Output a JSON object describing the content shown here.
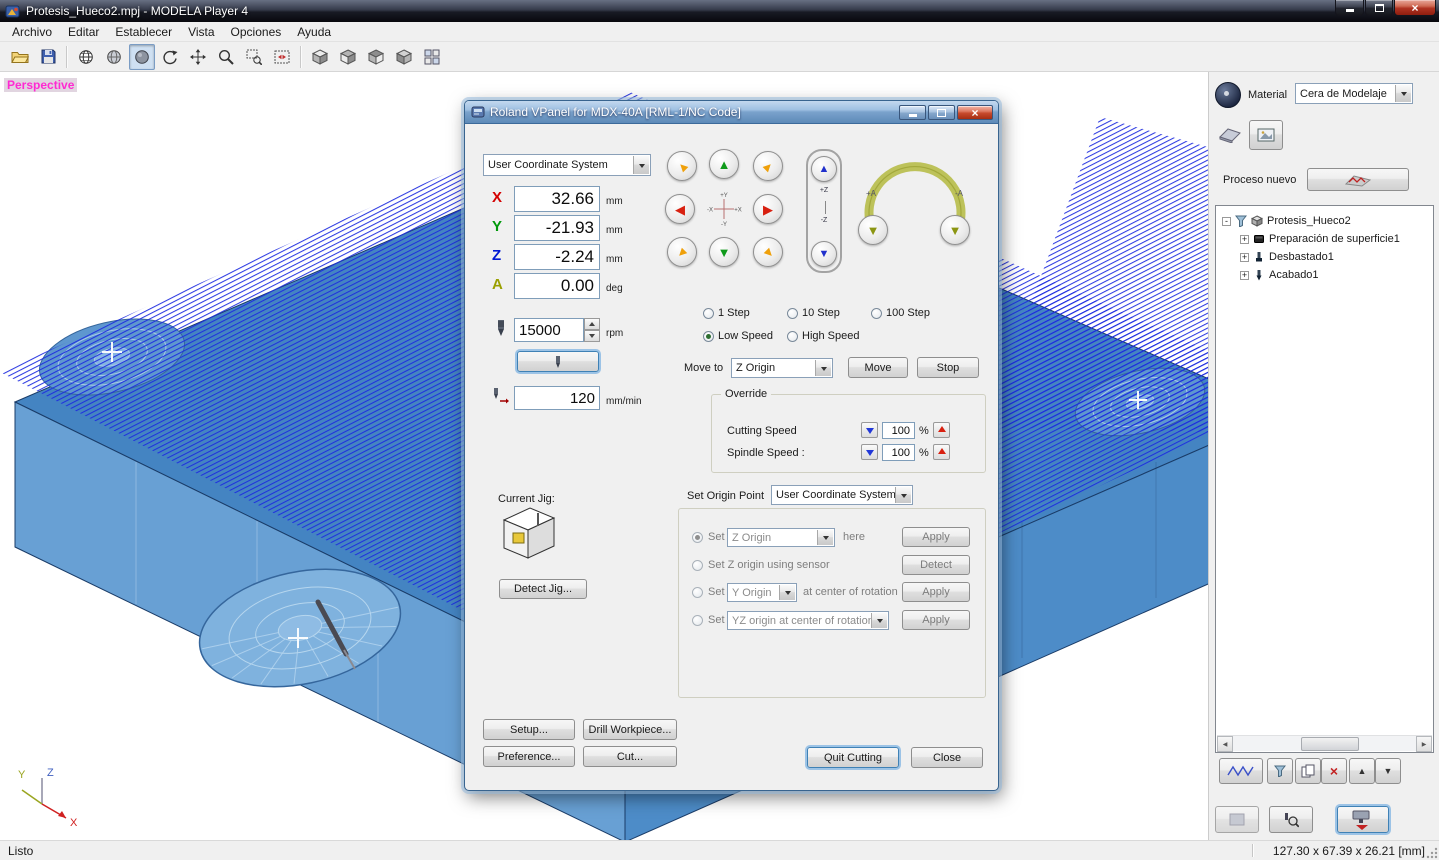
{
  "window": {
    "title": "Protesis_Hueco2.mpj - MODELA Player 4"
  },
  "menu": {
    "items": [
      "Archivo",
      "Editar",
      "Establecer",
      "Vista",
      "Opciones",
      "Ayuda"
    ]
  },
  "viewport": {
    "projection_label": "Perspective",
    "axis_labels": {
      "x": "X",
      "y": "Y",
      "z": "Z"
    }
  },
  "vpanel": {
    "title": "Roland VPanel for MDX-40A [RML-1/NC Code]",
    "coordinate_system_dropdown": "User Coordinate System",
    "coordinates": [
      {
        "axis": "X",
        "value": "32.66",
        "unit": "mm"
      },
      {
        "axis": "Y",
        "value": "-21.93",
        "unit": "mm"
      },
      {
        "axis": "Z",
        "value": "-2.24",
        "unit": "mm"
      },
      {
        "axis": "A",
        "value": "0.00",
        "unit": "deg"
      }
    ],
    "spindle_speed": {
      "value": "15000",
      "unit": "rpm"
    },
    "feed_rate": {
      "value": "120",
      "unit": "mm/min"
    },
    "jog": {
      "y_plus": "+Y",
      "y_minus": "-Y",
      "x_plus": "+X",
      "x_minus": "-X",
      "z_plus": "+Z",
      "z_minus": "-Z",
      "a_plus": "+A",
      "a_minus": "-A"
    },
    "step_options": [
      {
        "label": "1 Step"
      },
      {
        "label": "10 Step"
      },
      {
        "label": "100 Step"
      }
    ],
    "speed_options": [
      {
        "label": "Low Speed",
        "selected": true
      },
      {
        "label": "High Speed",
        "selected": false
      }
    ],
    "move_to": {
      "label": "Move to",
      "selected": "Z Origin",
      "move_button": "Move",
      "stop_button": "Stop"
    },
    "override": {
      "title": "Override",
      "rows": [
        {
          "label": "Cutting Speed",
          "value": "100",
          "unit": "%"
        },
        {
          "label": "Spindle Speed :",
          "value": "100",
          "unit": "%"
        }
      ]
    },
    "set_origin": {
      "label": "Set Origin Point",
      "system_dropdown": "User Coordinate System",
      "row1": {
        "prefix": "Set",
        "dropdown": "Z Origin",
        "suffix": "here",
        "button": "Apply"
      },
      "row2": {
        "label": "Set Z origin using sensor",
        "button": "Detect"
      },
      "row3": {
        "prefix": "Set",
        "dropdown": "Y Origin",
        "suffix": "at center of rotation",
        "button": "Apply"
      },
      "row4": {
        "prefix": "Set",
        "dropdown": "YZ origin at center of rotation",
        "button": "Apply"
      }
    },
    "current_jig_label": "Current Jig:",
    "buttons": {
      "detect_jig": "Detect Jig...",
      "setup": "Setup...",
      "drill_workpiece": "Drill Workpiece...",
      "preference": "Preference...",
      "cut": "Cut...",
      "quit_cutting": "Quit Cutting",
      "close": "Close"
    }
  },
  "right_panel": {
    "material_label": "Material",
    "material_value": "Cera de Modelaje",
    "new_process_label": "Proceso nuevo",
    "tree": {
      "root": "Protesis_Hueco2",
      "items": [
        "Preparación de superficie1",
        "Desbastado1",
        "Acabado1"
      ]
    }
  },
  "status_bar": {
    "message": "Listo",
    "dimensions": "127.30 x 67.39 x 26.21 [mm]"
  },
  "colors": {
    "axis_x": "#d40000",
    "axis_y": "#00990a",
    "axis_z": "#0018d4",
    "axis_a": "#9aa000",
    "toolpath": "#1c2ae0",
    "model_top": "#4484c2",
    "model_left": "#68a0d4",
    "model_right": "#4d8cc8",
    "perspective_label": "#ff2ad2",
    "dialog_title": "#7aa2cc"
  },
  "icons": {
    "close": "×",
    "jog_up": "▲",
    "jog_down": "▼",
    "jog_left": "◀",
    "jog_right": "▶",
    "scroll_left": "◀",
    "scroll_right": "▶",
    "move_up": "▲",
    "move_down": "▼",
    "delete": "×",
    "expand": "+",
    "collapse": "-"
  }
}
